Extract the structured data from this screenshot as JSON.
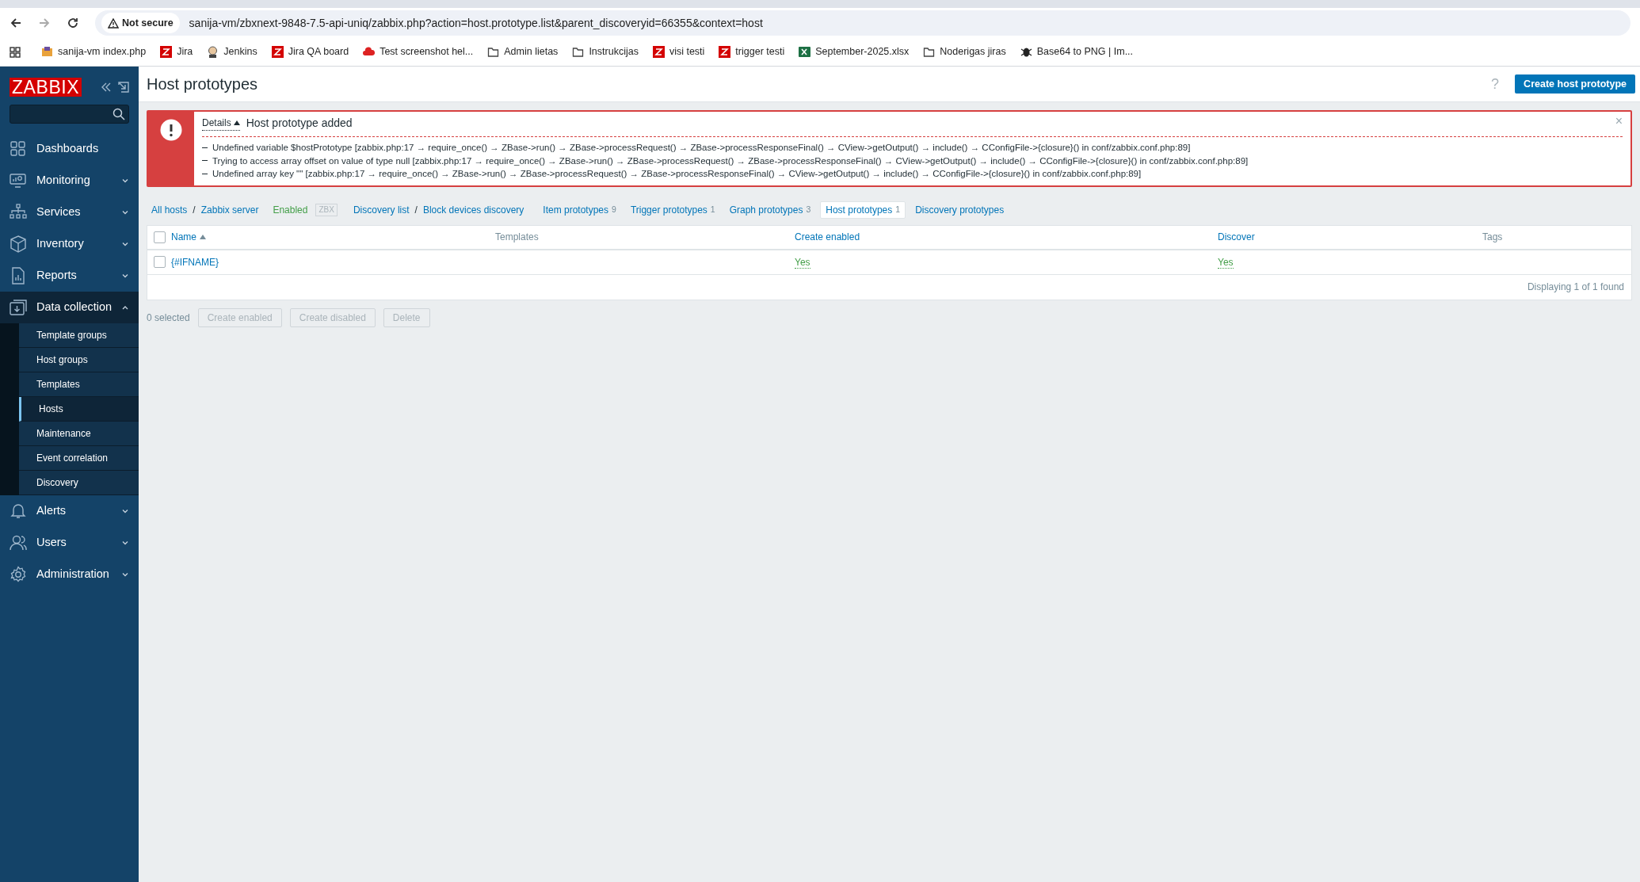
{
  "browser": {
    "security": "Not secure",
    "url": "sanija-vm/zbxnext-9848-7.5-api-uniq/zabbix.php?action=host.prototype.list&parent_discoveryid=66355&context=host"
  },
  "bookmarks": [
    {
      "label": "sanija-vm index.php",
      "kind": "site"
    },
    {
      "label": "Jira",
      "kind": "zabbix"
    },
    {
      "label": "Jenkins",
      "kind": "jenkins"
    },
    {
      "label": "Jira QA board",
      "kind": "zabbix"
    },
    {
      "label": "Test screenshot hel...",
      "kind": "cloud"
    },
    {
      "label": "Admin lietas",
      "kind": "folder"
    },
    {
      "label": "Instrukcijas",
      "kind": "folder"
    },
    {
      "label": "visi testi",
      "kind": "zabbix"
    },
    {
      "label": "trigger testi",
      "kind": "zabbix"
    },
    {
      "label": "September-2025.xlsx",
      "kind": "excel"
    },
    {
      "label": "Noderigas jiras",
      "kind": "folder"
    },
    {
      "label": "Base64 to PNG | Im...",
      "kind": "bug"
    }
  ],
  "sidebar": {
    "logo": "ZABBIX",
    "menu": [
      {
        "label": "Dashboards",
        "expanded": false,
        "has_submenu": false,
        "selected": false
      },
      {
        "label": "Monitoring",
        "expanded": false,
        "has_submenu": true,
        "selected": false
      },
      {
        "label": "Services",
        "expanded": false,
        "has_submenu": true,
        "selected": false
      },
      {
        "label": "Inventory",
        "expanded": false,
        "has_submenu": true,
        "selected": false
      },
      {
        "label": "Reports",
        "expanded": false,
        "has_submenu": true,
        "selected": false
      },
      {
        "label": "Data collection",
        "expanded": true,
        "has_submenu": true,
        "selected": true,
        "children": [
          {
            "label": "Template groups",
            "selected": false
          },
          {
            "label": "Host groups",
            "selected": false
          },
          {
            "label": "Templates",
            "selected": false
          },
          {
            "label": "Hosts",
            "selected": true
          },
          {
            "label": "Maintenance",
            "selected": false
          },
          {
            "label": "Event correlation",
            "selected": false
          },
          {
            "label": "Discovery",
            "selected": false
          }
        ]
      },
      {
        "label": "Alerts",
        "expanded": false,
        "has_submenu": true,
        "selected": false
      },
      {
        "label": "Users",
        "expanded": false,
        "has_submenu": true,
        "selected": false
      },
      {
        "label": "Administration",
        "expanded": false,
        "has_submenu": true,
        "selected": false
      }
    ]
  },
  "header": {
    "title": "Host prototypes",
    "help": "?",
    "create_button": "Create host prototype"
  },
  "message": {
    "details": "Details",
    "title": "Host prototype added",
    "close": "×",
    "lines": [
      "Undefined variable $hostPrototype [zabbix.php:17 → require_once() → ZBase->run() → ZBase->processRequest() → ZBase->processResponseFinal() → CView->getOutput() → include() → CConfigFile->{closure}() in conf/zabbix.conf.php:89]",
      "Trying to access array offset on value of type null [zabbix.php:17 → require_once() → ZBase->run() → ZBase->processRequest() → ZBase->processResponseFinal() → CView->getOutput() → include() → CConfigFile->{closure}() in conf/zabbix.conf.php:89]",
      "Undefined array key \"\" [zabbix.php:17 → require_once() → ZBase->run() → ZBase->processRequest() → ZBase->processResponseFinal() → CView->getOutput() → include() → CConfigFile->{closure}() in conf/zabbix.conf.php:89]"
    ]
  },
  "breadcrumbs": [
    {
      "kind": "link",
      "label": "All hosts",
      "separator": "/"
    },
    {
      "kind": "link",
      "label": "Zabbix server"
    },
    {
      "kind": "status",
      "label": "Enabled"
    },
    {
      "kind": "tag",
      "label": "ZBX"
    },
    {
      "kind": "link",
      "label": "Discovery list",
      "separator": "/"
    },
    {
      "kind": "link",
      "label": "Block devices discovery"
    },
    {
      "kind": "tab",
      "label": "Item prototypes",
      "count": "9",
      "selected": false
    },
    {
      "kind": "tab",
      "label": "Trigger prototypes",
      "count": "1",
      "selected": false
    },
    {
      "kind": "tab",
      "label": "Graph prototypes",
      "count": "3",
      "selected": false
    },
    {
      "kind": "tab",
      "label": "Host prototypes",
      "count": "1",
      "selected": true
    },
    {
      "kind": "tab",
      "label": "Discovery prototypes",
      "selected": false
    }
  ],
  "table": {
    "all_checked": false,
    "columns": [
      {
        "label": "Name",
        "link": true,
        "sorted": true
      },
      {
        "label": "Templates",
        "link": false,
        "sorted": false
      },
      {
        "label": "Create enabled",
        "link": true,
        "sorted": false
      },
      {
        "label": "Discover",
        "link": true,
        "sorted": false
      },
      {
        "label": "Tags",
        "link": false,
        "sorted": false
      }
    ],
    "rows": [
      {
        "checked": false,
        "name": "{#IFNAME}",
        "create_enabled": "Yes",
        "discover": "Yes"
      }
    ],
    "footer": "Displaying 1 of 1 found"
  },
  "actions": {
    "selected_count": "0 selected",
    "buttons": [
      "Create enabled",
      "Create disabled",
      "Delete"
    ]
  }
}
